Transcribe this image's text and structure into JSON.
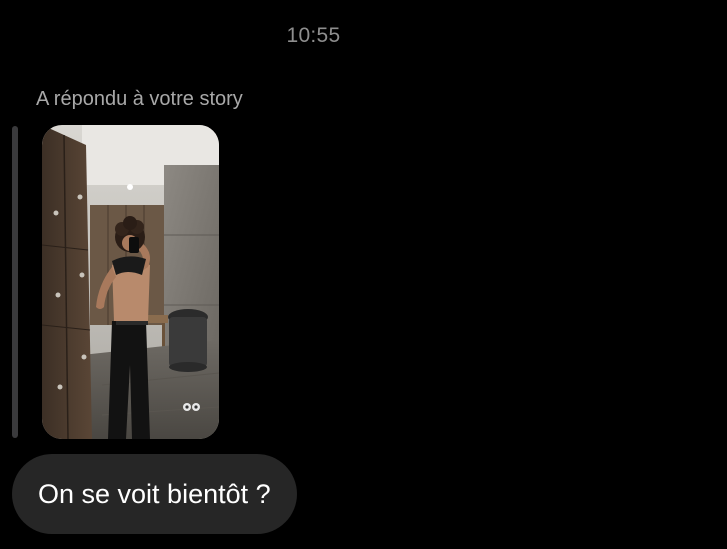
{
  "header": {
    "time": "10:55"
  },
  "story_reply": {
    "label": "A répondu à votre story",
    "thumbnail_icon": "story-photo-icon"
  },
  "messages": [
    {
      "text": "On se voit bientôt ?"
    }
  ],
  "colors": {
    "background": "#000000",
    "bubble": "#262626",
    "secondary_text": "#a8a8a8",
    "reply_bar": "#3a3a3c"
  }
}
